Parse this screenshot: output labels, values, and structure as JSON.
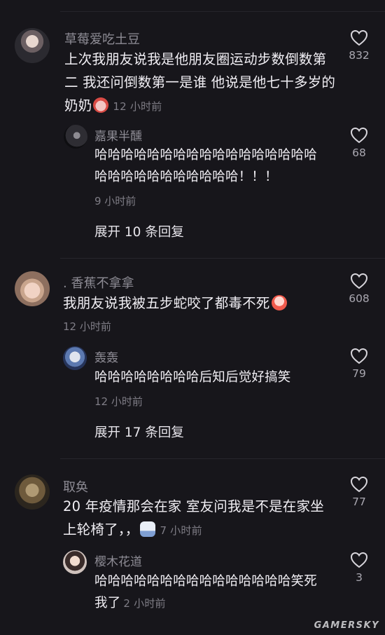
{
  "comments": [
    {
      "user": "草莓爱吃土豆",
      "text": "上次我朋友说我是他朋友圈运动步数倒数第二 我还问倒数第一是谁 他说是他七十多岁的奶奶",
      "emoji": "angry-face-emoji",
      "time": "12 小时前",
      "likes": "832",
      "reply": {
        "user": "嘉果半醺",
        "text": "哈哈哈哈哈哈哈哈哈哈哈哈哈哈哈哈哈哈哈哈哈哈哈哈哈哈哈哈！！！",
        "time": "9 小时前",
        "likes": "68"
      },
      "expand_label": "展开 10 条回复"
    },
    {
      "user": ". 香蕉不拿拿",
      "text": "我朋友说我被五步蛇咬了都毒不死",
      "emoji": "crying-laughing-emoji",
      "time": "12 小时前",
      "likes": "608",
      "reply": {
        "user": "轰轰",
        "text": "哈哈哈哈哈哈哈哈后知后觉好搞笑",
        "time": "12 小时前",
        "likes": "79"
      },
      "expand_label": "展开 17 条回复"
    },
    {
      "user": "取奂",
      "text": "20 年疫情那会在家 室友问我是不是在家坐上轮椅了，，",
      "emoji": "sweat-smile-emoji",
      "time": "7 小时前",
      "likes": "77",
      "reply": {
        "user": "樱木花道",
        "text": "哈哈哈哈哈哈哈哈哈哈哈哈哈哈哈笑死我了",
        "time": "2 小时前",
        "likes": "3"
      }
    }
  ],
  "watermark": "GAMERSKY",
  "colors": {
    "background": "#17161b",
    "username": "#8e8c95",
    "text": "#f1eff4",
    "meta": "#7f7d86"
  }
}
